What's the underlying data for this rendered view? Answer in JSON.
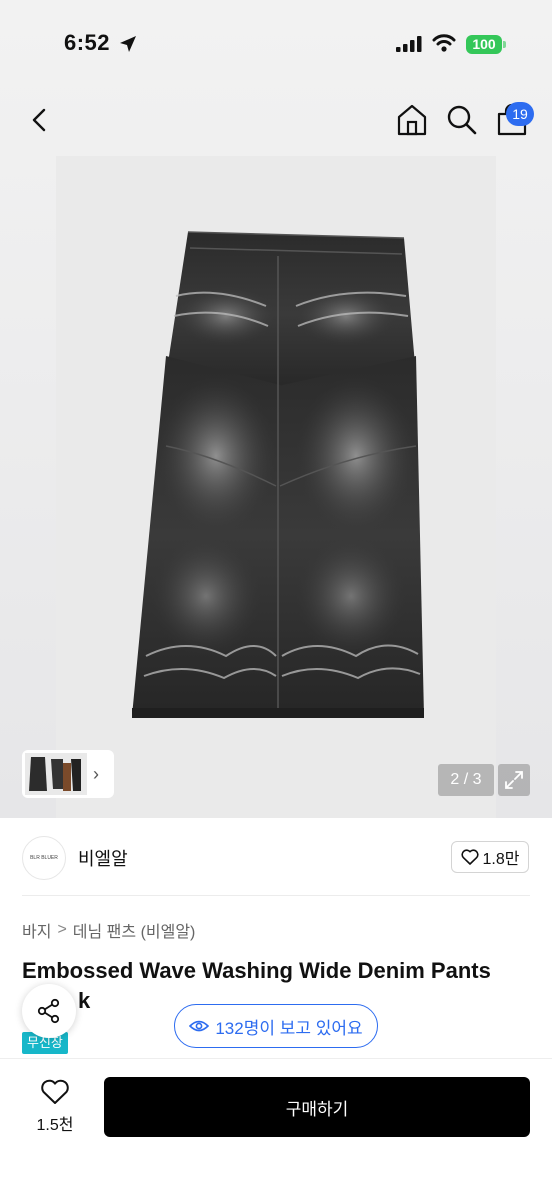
{
  "status_bar": {
    "time": "6:52",
    "battery": "100"
  },
  "header": {
    "cart_count": "19"
  },
  "gallery": {
    "page_indicator": "2 / 3"
  },
  "brand": {
    "logo_text": "BLR BLUER",
    "name": "비엘알",
    "likes": "1.8만"
  },
  "breadcrumb": {
    "category": "바지",
    "separator": ">",
    "subcategory": "데님 팬츠 (비엘알)"
  },
  "product": {
    "title": "Embossed Wave Washing Wide Denim Pants",
    "title_line2": "k",
    "badge": "무신장"
  },
  "viewers": {
    "text": "132명이 보고 있어요"
  },
  "bottom_bar": {
    "wish_count": "1.5천",
    "buy_label": "구매하기"
  },
  "colors": {
    "accent": "#2d6cf0",
    "badge": "#17b7c9",
    "battery": "#34c759",
    "buy_button": "#000000"
  }
}
